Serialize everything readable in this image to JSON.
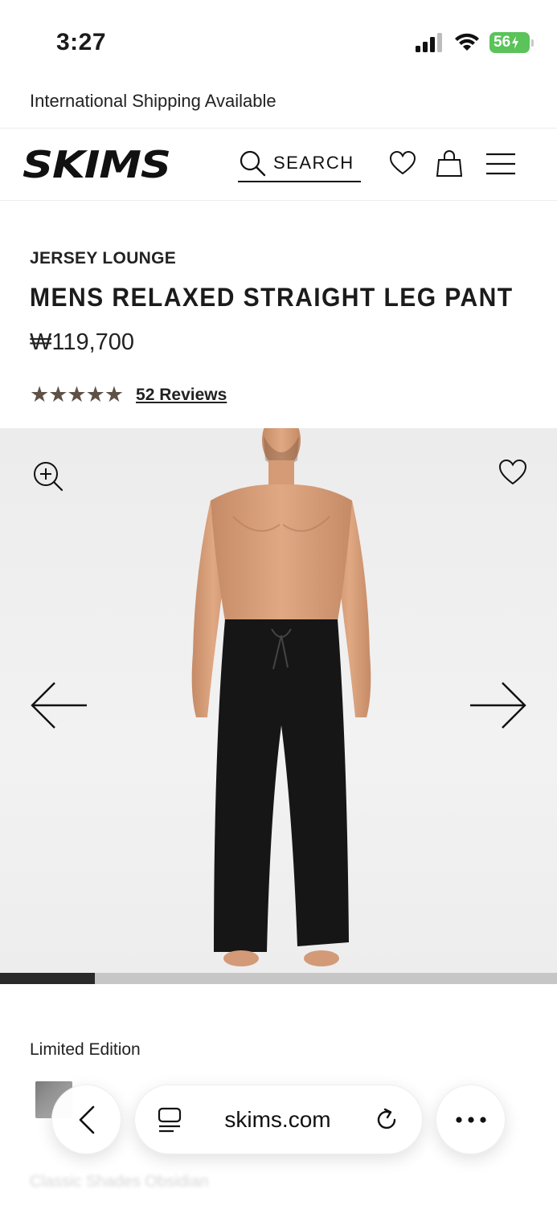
{
  "status": {
    "time": "3:27",
    "battery": "56"
  },
  "promo": {
    "text": "International Shipping Available"
  },
  "header": {
    "logo": "SKIMS",
    "search_label": "SEARCH"
  },
  "product": {
    "collection": "JERSEY LOUNGE",
    "title": "MENS RELAXED STRAIGHT LEG PANT",
    "price": "₩119,700",
    "rating": 5,
    "reviews_label": "52 Reviews"
  },
  "gallery": {
    "progress": 0.17
  },
  "color_section": {
    "label": "Limited Edition",
    "faded_text": "Classic Shades    Obsidian"
  },
  "browser": {
    "url": "skims.com"
  },
  "colors": {
    "accent_star": "#5f5146",
    "battery": "#5ac35a"
  }
}
